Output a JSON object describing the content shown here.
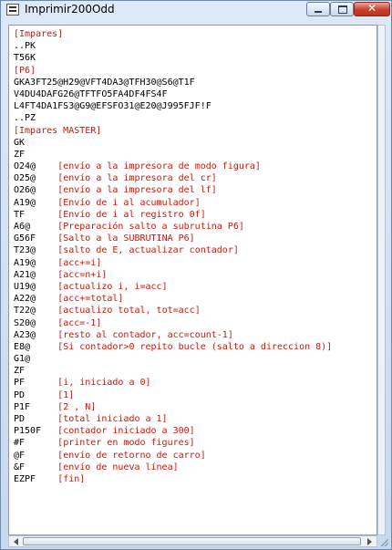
{
  "window": {
    "title": "Imprimir200Odd"
  },
  "lines": [
    {
      "code": "[Impares]",
      "comment": "",
      "kind": "section"
    },
    {
      "code": "..PK",
      "comment": "",
      "kind": "code"
    },
    {
      "code": "T56K",
      "comment": "",
      "kind": "code"
    },
    {
      "code": "[P6]",
      "comment": "",
      "kind": "section"
    },
    {
      "code": "GKA3FT25@H29@VFT4DA3@TFH30@S6@T1F",
      "comment": "",
      "kind": "code"
    },
    {
      "code": "V4DU4DAFG26@TFTFO5FA4DF4FS4F",
      "comment": "",
      "kind": "code"
    },
    {
      "code": "L4FT4DA1FS3@G9@EFSFO31@E20@J995FJF!F",
      "comment": "",
      "kind": "code"
    },
    {
      "code": "..PZ",
      "comment": "",
      "kind": "code"
    },
    {
      "code": "[Impares MASTER]",
      "comment": "",
      "kind": "section"
    },
    {
      "code": "GK",
      "comment": "",
      "kind": "code"
    },
    {
      "code": "ZF",
      "comment": "",
      "kind": "code"
    },
    {
      "code": "O24@",
      "comment": "[envío a la impresora de modo figura]",
      "kind": "code"
    },
    {
      "code": "O25@",
      "comment": "[envío a la impresora del cr]",
      "kind": "code"
    },
    {
      "code": "O26@",
      "comment": "[envío a la impresora del lf]",
      "kind": "code"
    },
    {
      "code": "A19@",
      "comment": "[Envío de i al acumulador]",
      "kind": "code"
    },
    {
      "code": "TF",
      "comment": "[Envío de i al registro 0f]",
      "kind": "code"
    },
    {
      "code": "A6@",
      "comment": "[Preparación salto a subrutina P6]",
      "kind": "code"
    },
    {
      "code": "G56F",
      "comment": "[Salto a la SUBRUTINA P6]",
      "kind": "code"
    },
    {
      "code": "T23@",
      "comment": "[salto de E, actualizar contador]",
      "kind": "code"
    },
    {
      "code": "A19@",
      "comment": "[acc+=i]",
      "kind": "code"
    },
    {
      "code": "A21@",
      "comment": "[acc=n+i]",
      "kind": "code"
    },
    {
      "code": "U19@",
      "comment": "[actualizo i, i=acc]",
      "kind": "code"
    },
    {
      "code": "A22@",
      "comment": "[acc+=total]",
      "kind": "code"
    },
    {
      "code": "T22@",
      "comment": "[actualizo total, tot=acc]",
      "kind": "code"
    },
    {
      "code": "S20@",
      "comment": "[acc=-1]",
      "kind": "code"
    },
    {
      "code": "A23@",
      "comment": "[resto al contador, acc=count-1]",
      "kind": "code"
    },
    {
      "code": "E8@",
      "comment": "[Si contador>0 repito bucle (salto a direccion 8)]",
      "kind": "code"
    },
    {
      "code": "G1@",
      "comment": "",
      "kind": "code"
    },
    {
      "code": "ZF",
      "comment": "",
      "kind": "code"
    },
    {
      "code": "PF",
      "comment": "[i, iniciado a 0]",
      "kind": "code"
    },
    {
      "code": "PD",
      "comment": "[1]",
      "kind": "code"
    },
    {
      "code": "P1F",
      "comment": "[2 , N]",
      "kind": "code"
    },
    {
      "code": "PD",
      "comment": "[total iniciado a 1]",
      "kind": "code"
    },
    {
      "code": "P150F",
      "comment": "[contador iniciado a 300]",
      "kind": "code"
    },
    {
      "code": "#F",
      "comment": "[printer en modo figures]",
      "kind": "code"
    },
    {
      "code": "@F",
      "comment": "[envío de retorno de carro]",
      "kind": "code"
    },
    {
      "code": "&F",
      "comment": "[envío de nueva línea]",
      "kind": "code"
    },
    {
      "code": "EZPF",
      "comment": "[fin]",
      "kind": "code"
    }
  ]
}
